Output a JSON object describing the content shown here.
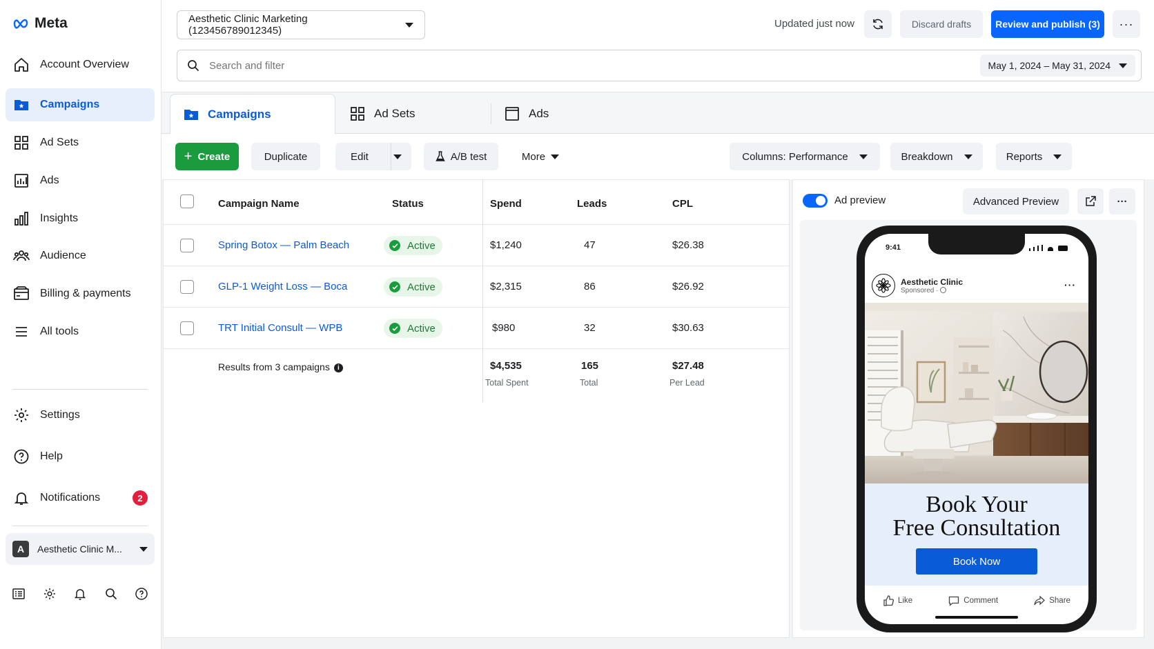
{
  "brand": {
    "name": "Meta"
  },
  "sidebar": {
    "items": [
      {
        "label": "Account Overview",
        "icon": "home-icon"
      },
      {
        "label": "Campaigns",
        "icon": "campaign-folder-icon",
        "active": true
      },
      {
        "label": "Ad Sets",
        "icon": "grid-icon"
      },
      {
        "label": "Ads",
        "icon": "ads-chart-icon"
      },
      {
        "label": "Insights",
        "icon": "bar-chart-icon"
      },
      {
        "label": "Audience",
        "icon": "people-icon"
      },
      {
        "label": "Billing & payments",
        "icon": "billing-icon"
      },
      {
        "label": "All tools",
        "icon": "menu-icon"
      }
    ],
    "secondary": [
      {
        "label": "Settings",
        "icon": "gear-icon"
      },
      {
        "label": "Help",
        "icon": "help-icon"
      },
      {
        "label": "Notifications",
        "icon": "bell-icon",
        "badge": "2"
      }
    ],
    "account": {
      "avatar": "A",
      "label": "Aesthetic Clinic M..."
    }
  },
  "header": {
    "account_select": "Aesthetic Clinic Marketing (123456789012345)",
    "updated": "Updated just now",
    "discard": "Discard drafts",
    "publish": "Review and publish (3)",
    "search_placeholder": "Search and filter",
    "date_range": "May 1, 2024 – May 31, 2024"
  },
  "tabs": [
    {
      "label": "Campaigns",
      "active": true
    },
    {
      "label": "Ad Sets"
    },
    {
      "label": "Ads"
    }
  ],
  "toolbar": {
    "create": "Create",
    "duplicate": "Duplicate",
    "edit": "Edit",
    "ab_test": "A/B test",
    "more": "More",
    "columns": "Columns: Performance",
    "breakdown": "Breakdown",
    "reports": "Reports"
  },
  "table": {
    "headers": {
      "name": "Campaign Name",
      "status": "Status",
      "spend": "Spend",
      "leads": "Leads",
      "cpl": "CPL"
    },
    "rows": [
      {
        "name": "Spring Botox — Palm Beach",
        "status": "Active",
        "spend": "$1,240",
        "leads": "47",
        "cpl": "$26.38"
      },
      {
        "name": "GLP-1 Weight Loss — Boca",
        "status": "Active",
        "spend": "$2,315",
        "leads": "86",
        "cpl": "$26.92"
      },
      {
        "name": "TRT Initial Consult — WPB",
        "status": "Active",
        "spend": "$980",
        "leads": "32",
        "cpl": "$30.63"
      }
    ],
    "totals": {
      "label": "Results from 3 campaigns",
      "spend": "$4,535",
      "spend_sub": "Total Spent",
      "leads": "165",
      "leads_sub": "Total",
      "cpl": "$27.48",
      "cpl_sub": "Per Lead"
    }
  },
  "preview": {
    "toggle_label": "Ad preview",
    "advanced": "Advanced Preview",
    "phone_time": "9:41",
    "page_name": "Aesthetic Clinic",
    "sponsored": "Sponsored ·",
    "headline_1": "Book Your",
    "headline_2": "Free Consultation",
    "cta": "Book Now",
    "like": "Like",
    "comment": "Comment",
    "share": "Share"
  },
  "colors": {
    "accent": "#0866ff",
    "create": "#1a9c3e",
    "link": "#0a5bd8",
    "badge": "#e41e3f"
  }
}
